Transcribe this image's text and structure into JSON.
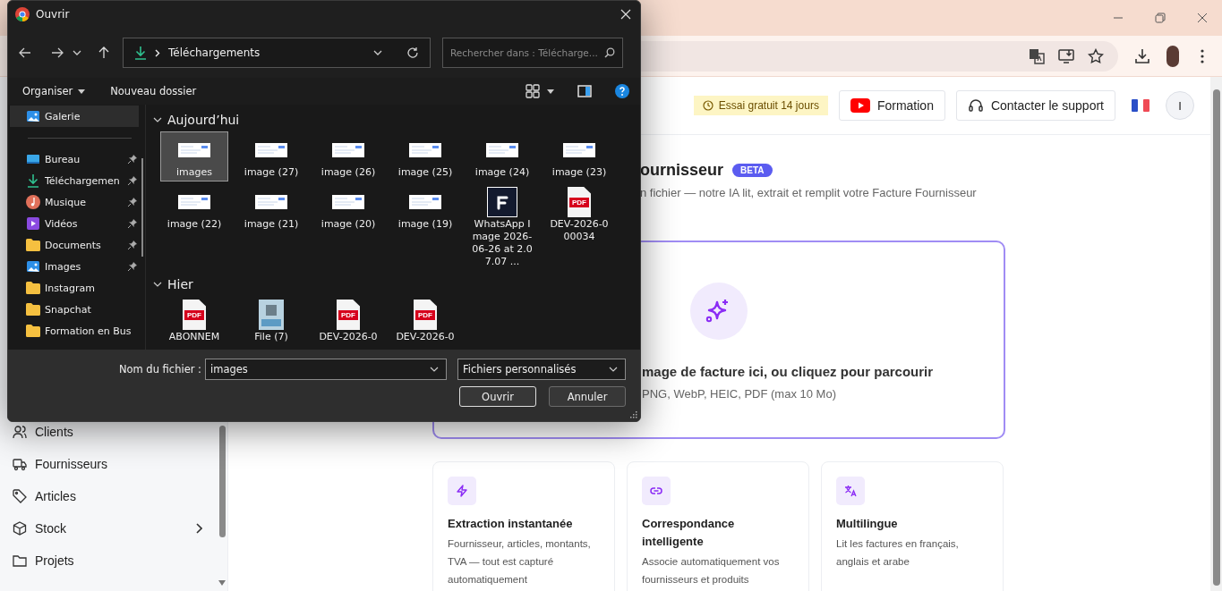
{
  "dialog": {
    "title": "Ouvrir",
    "path": "Téléchargements",
    "search_placeholder": "Rechercher dans : Télécharge...",
    "commands": [
      "Organiser",
      "Nouveau dossier"
    ],
    "nav": [
      {
        "label": "Galerie",
        "kind": "gallery",
        "selected": true,
        "pinned": false
      },
      {
        "label": "Bureau",
        "kind": "desktop",
        "selected": false,
        "pinned": true
      },
      {
        "label": "Téléchargemen",
        "kind": "download",
        "selected": false,
        "pinned": true
      },
      {
        "label": "Musique",
        "kind": "music",
        "selected": false,
        "pinned": true
      },
      {
        "label": "Vidéos",
        "kind": "video",
        "selected": false,
        "pinned": true
      },
      {
        "label": "Documents",
        "kind": "folder",
        "selected": false,
        "pinned": true
      },
      {
        "label": "Images",
        "kind": "pictures",
        "selected": false,
        "pinned": true
      },
      {
        "label": "Instagram",
        "kind": "folder",
        "selected": false,
        "pinned": false
      },
      {
        "label": "Snapchat",
        "kind": "folder",
        "selected": false,
        "pinned": false
      },
      {
        "label": "Formation en Bus",
        "kind": "folder",
        "selected": false,
        "pinned": false
      }
    ],
    "groups": [
      {
        "label": "Aujourd’hui",
        "files": [
          {
            "name": "images",
            "kind": "image",
            "selected": true
          },
          {
            "name": "image (27)",
            "kind": "image",
            "selected": false
          },
          {
            "name": "image (26)",
            "kind": "image",
            "selected": false
          },
          {
            "name": "image (25)",
            "kind": "image",
            "selected": false
          },
          {
            "name": "image (24)",
            "kind": "image",
            "selected": false
          },
          {
            "name": "image (23)",
            "kind": "image",
            "selected": false
          },
          {
            "name": "image (22)",
            "kind": "image",
            "selected": false
          },
          {
            "name": "image (21)",
            "kind": "image",
            "selected": false
          },
          {
            "name": "image (20)",
            "kind": "image",
            "selected": false
          },
          {
            "name": "image (19)",
            "kind": "image",
            "selected": false
          },
          {
            "name": "WhatsApp Image 2026-06-26 at 2.07.07 ...",
            "kind": "app",
            "selected": false
          },
          {
            "name": "DEV-2026-000034",
            "kind": "pdf",
            "icon_text": "PDF",
            "selected": false
          }
        ]
      },
      {
        "label": "Hier",
        "files": [
          {
            "name": "ABONNEM",
            "kind": "pdf",
            "icon_text": "PDF",
            "selected": false
          },
          {
            "name": "File (7)",
            "kind": "photo",
            "selected": false
          },
          {
            "name": "DEV-2026-0",
            "kind": "pdf",
            "icon_text": "PDF",
            "selected": false
          },
          {
            "name": "DEV-2026-0",
            "kind": "pdf",
            "icon_text": "PDF",
            "selected": false
          }
        ]
      }
    ],
    "filename_label": "Nom du fichier :",
    "filename": "images",
    "filetype": "Fichiers personnalisés",
    "buttons": [
      "Ouvrir",
      "Annuler"
    ]
  },
  "header": {
    "trial": "Essai gratuit 14 jours",
    "buttons": [
      {
        "label": "Formation",
        "kind": "video"
      },
      {
        "label": "Contacter le support",
        "kind": "support"
      }
    ],
    "avatar": "I"
  },
  "sidebar": [
    {
      "label": "Clients",
      "kind": "users",
      "expandable": false
    },
    {
      "label": "Fournisseurs",
      "kind": "truck",
      "expandable": false
    },
    {
      "label": "Articles",
      "kind": "tag",
      "expandable": false
    },
    {
      "label": "Stock",
      "kind": "box",
      "expandable": true
    },
    {
      "label": "Projets",
      "kind": "folder",
      "expandable": false
    }
  ],
  "page": {
    "title": "ournisseur",
    "badge": "BETA",
    "subtitle": "n fichier — notre IA lit, extrait et remplit votre Facture Fournisseur",
    "drop_title": "mage de facture ici, ou cliquez pour parcourir",
    "drop_hint": "PNG, WebP, HEIC, PDF (max 10 Mo)"
  },
  "features": [
    {
      "kind": "bolt",
      "title": "Extraction instantanée",
      "text": "Fournisseur, articles, montants, TVA — tout est capturé automatiquement"
    },
    {
      "kind": "link",
      "title": "Correspondance intelligente",
      "text": "Associe automatiquement vos fournisseurs et produits"
    },
    {
      "kind": "translate",
      "title": "Multilingue",
      "text": "Lit les factures en français, anglais et arabe"
    }
  ]
}
